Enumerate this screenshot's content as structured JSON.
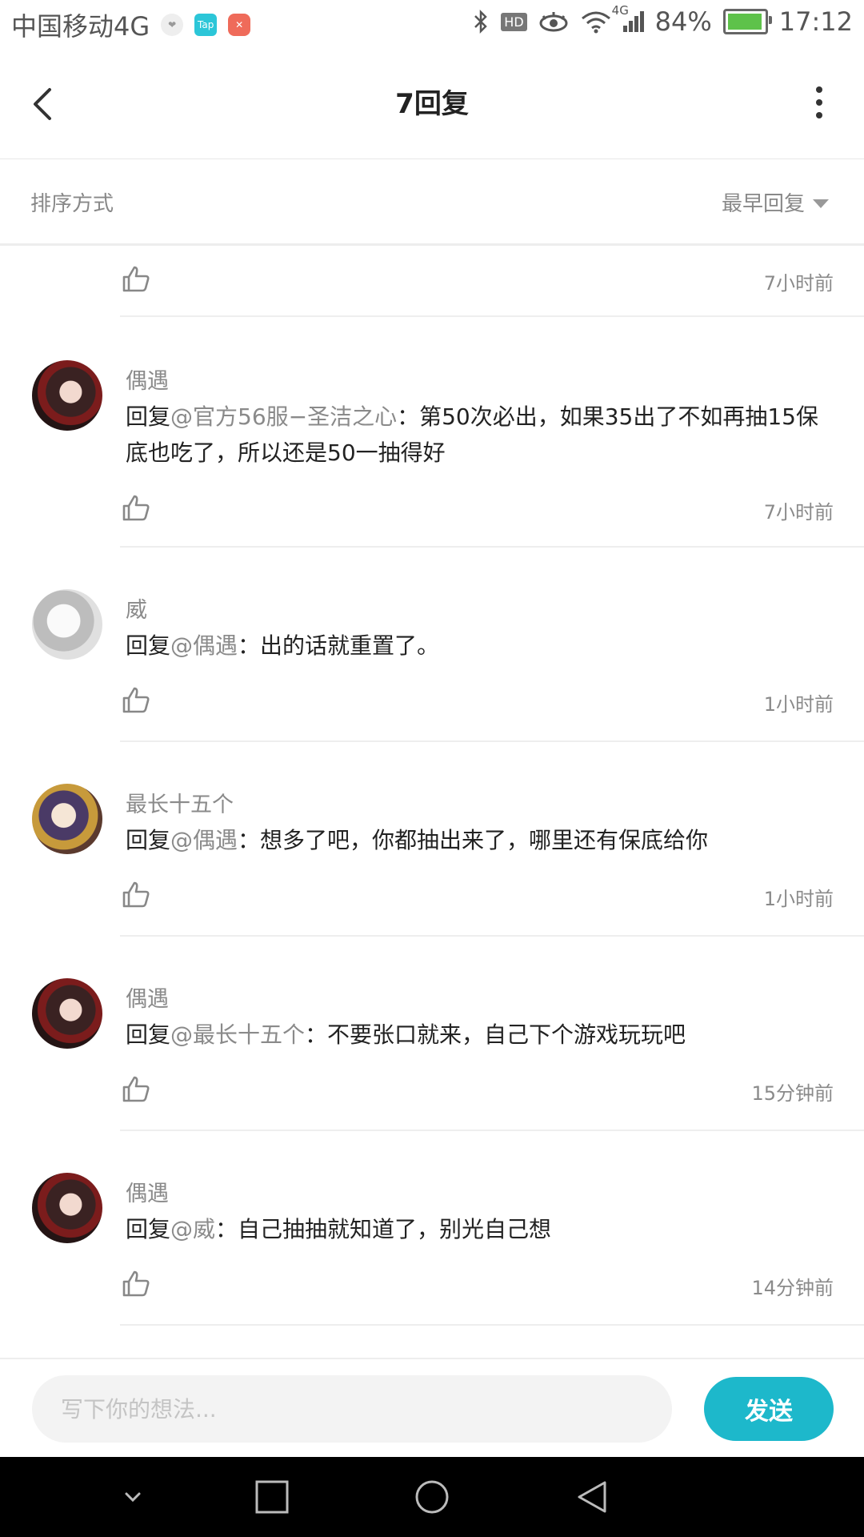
{
  "status_bar": {
    "carrier": "中国移动4G",
    "network_badge": "4G",
    "battery": "84%",
    "time": "17:12",
    "icons": [
      "heart-app-icon",
      "tap-app-icon",
      "red-app-icon",
      "bluetooth-icon",
      "hd-icon",
      "eye-icon",
      "wifi-icon",
      "signal-icon",
      "battery-icon"
    ],
    "tap_label": "Tap",
    "hd_label": "HD"
  },
  "header": {
    "title": "7回复"
  },
  "sort": {
    "label": "排序方式",
    "selected": "最早回复"
  },
  "replies": [
    {
      "time": "7小时前",
      "partial": true
    },
    {
      "username": "偶遇",
      "reply_prefix": "回复",
      "mention": "@官方56服−圣洁之心",
      "text": "：第50次必出，如果35出了不如再抽15保底也吃了，所以还是50一抽得好",
      "time": "7小时前",
      "avatar": "fox-girl"
    },
    {
      "username": "威",
      "reply_prefix": "回复",
      "mention": "@偶遇",
      "text": "：出的话就重置了。",
      "time": "1小时前",
      "avatar": "gray-sketch"
    },
    {
      "username": "最长十五个",
      "reply_prefix": "回复",
      "mention": "@偶遇",
      "text": "：想多了吧，你都抽出来了，哪里还有保底给你",
      "time": "1小时前",
      "avatar": "warrior"
    },
    {
      "username": "偶遇",
      "reply_prefix": "回复",
      "mention": "@最长十五个",
      "text": "：不要张口就来，自己下个游戏玩玩吧",
      "time": "15分钟前",
      "avatar": "fox-girl"
    },
    {
      "username": "偶遇",
      "reply_prefix": "回复",
      "mention": "@威",
      "text": "：自己抽抽就知道了，别光自己想",
      "time": "14分钟前",
      "avatar": "fox-girl"
    }
  ],
  "composer": {
    "placeholder": "写下你的想法...",
    "send_label": "发送"
  },
  "colors": {
    "accent": "#1db8cb",
    "mention": "#8a8a8a"
  }
}
